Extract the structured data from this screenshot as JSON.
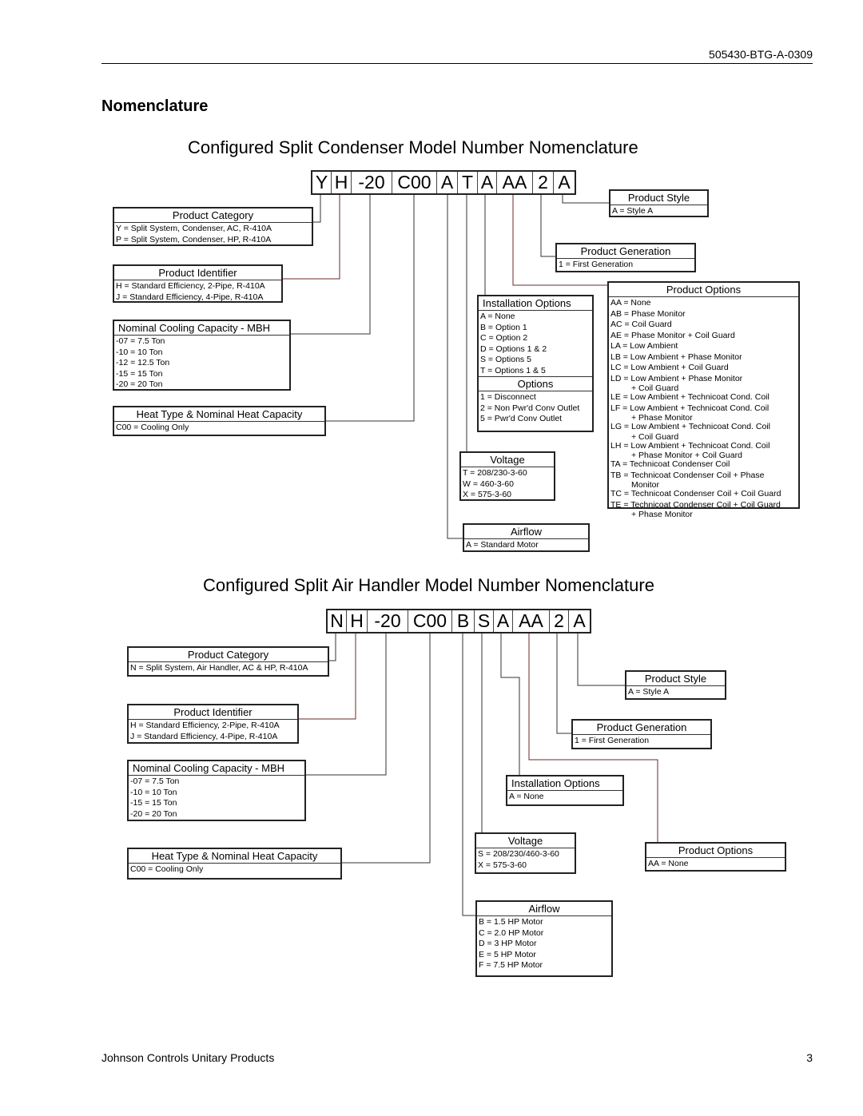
{
  "header": {
    "doc_number": "505430-BTG-A-0309"
  },
  "section_title": "Nomenclature",
  "diagrams": [
    {
      "title": "Configured Split Condenser Model Number Nomenclature",
      "codes": [
        "Y",
        "H",
        "-20",
        "C00",
        "A",
        "T",
        "A",
        "AA",
        "2",
        "A"
      ],
      "boxes": [
        {
          "name": "product-category",
          "sections": [
            {
              "title": "Product Category",
              "items": [
                "Y = Split System, Condenser, AC, R-410A",
                "P = Split System, Condenser, HP, R-410A"
              ]
            }
          ]
        },
        {
          "name": "product-identifier",
          "sections": [
            {
              "title": "Product Identifier",
              "items": [
                "H = Standard Efficiency, 2-Pipe, R-410A",
                "J = Standard Efficiency, 4-Pipe, R-410A"
              ]
            }
          ]
        },
        {
          "name": "nominal-cooling-capacity",
          "sections": [
            {
              "title": "Nominal Cooling Capacity - MBH",
              "items": [
                "-07 = 7.5 Ton",
                "-10 = 10 Ton",
                "-12 = 12.5 Ton",
                "-15 = 15 Ton",
                "-20 = 20 Ton"
              ]
            }
          ]
        },
        {
          "name": "heat-type",
          "sections": [
            {
              "title": "Heat Type & Nominal Heat Capacity",
              "items": [
                "C00 = Cooling Only"
              ]
            }
          ]
        },
        {
          "name": "airflow",
          "sections": [
            {
              "title": "Airflow",
              "items": [
                "A = Standard Motor"
              ]
            }
          ]
        },
        {
          "name": "voltage",
          "sections": [
            {
              "title": "Voltage",
              "items": [
                "T = 208/230-3-60",
                "W = 460-3-60",
                "X = 575-3-60"
              ]
            }
          ]
        },
        {
          "name": "installation-options",
          "sections": [
            {
              "title": "Installation Options",
              "items": [
                "A = None",
                "B = Option 1",
                "C = Option 2",
                "D = Options 1 & 2",
                "S = Options 5",
                "T = Options 1 & 5"
              ]
            },
            {
              "title": "Options",
              "items": [
                "1 = Disconnect",
                "2 = Non Pwr'd Conv Outlet",
                "5 = Pwr'd Conv Outlet"
              ]
            }
          ]
        },
        {
          "name": "product-options",
          "sections": [
            {
              "title": "Product Options",
              "items": [
                "AA = None",
                "AB = Phase Monitor",
                "AC = Coil Guard",
                "AE = Phase Monitor + Coil Guard",
                "LA = Low Ambient",
                "LB = Low Ambient + Phase Monitor",
                "LC = Low Ambient + Coil Guard",
                "LD = Low Ambient + Phase Monitor\n+ Coil Guard",
                "LE = Low Ambient + Technicoat Cond. Coil",
                "LF = Low Ambient + Technicoat Cond. Coil\n+ Phase Monitor",
                "LG = Low Ambient + Technicoat Cond. Coil\n+ Coil Guard",
                "LH = Low Ambient + Technicoat Cond. Coil\n+ Phase Monitor + Coil Guard",
                "TA = Technicoat Condenser Coil",
                "TB = Technicoat Condenser Coil + Phase\nMonitor",
                "TC = Technicoat Condenser Coil + Coil Guard",
                "TE = Technicoat Condenser Coil + Coil Guard\n+ Phase Monitor"
              ]
            }
          ]
        },
        {
          "name": "product-generation",
          "sections": [
            {
              "title": "Product Generation",
              "items": [
                "1 = First Generation"
              ]
            }
          ]
        },
        {
          "name": "product-style",
          "sections": [
            {
              "title": "Product Style",
              "items": [
                "A = Style A"
              ]
            }
          ]
        }
      ]
    },
    {
      "title": "Configured Split Air Handler Model Number Nomenclature",
      "codes": [
        "N",
        "H",
        "-20",
        "C00",
        "B",
        "S",
        "A",
        "AA",
        "2",
        "A"
      ],
      "boxes": [
        {
          "name": "product-category",
          "sections": [
            {
              "title": "Product Category",
              "items": [
                "N = Split System, Air Handler, AC & HP, R-410A"
              ]
            }
          ]
        },
        {
          "name": "product-identifier",
          "sections": [
            {
              "title": "Product Identifier",
              "items": [
                "H = Standard Efficiency, 2-Pipe, R-410A",
                "J = Standard Efficiency, 4-Pipe, R-410A"
              ]
            }
          ]
        },
        {
          "name": "nominal-cooling-capacity",
          "sections": [
            {
              "title": "Nominal Cooling Capacity - MBH",
              "items": [
                "-07 = 7.5 Ton",
                "-10 = 10 Ton",
                "-15 = 15 Ton",
                "-20 = 20 Ton"
              ]
            }
          ]
        },
        {
          "name": "heat-type",
          "sections": [
            {
              "title": "Heat Type & Nominal Heat Capacity",
              "items": [
                "C00 = Cooling Only"
              ]
            }
          ]
        },
        {
          "name": "airflow",
          "sections": [
            {
              "title": "Airflow",
              "items": [
                "B = 1.5 HP Motor",
                "C = 2.0 HP Motor",
                "D = 3 HP Motor",
                "E = 5 HP Motor",
                "F = 7.5 HP Motor"
              ]
            }
          ]
        },
        {
          "name": "voltage",
          "sections": [
            {
              "title": "Voltage",
              "items": [
                "S = 208/230/460-3-60",
                "X = 575-3-60"
              ]
            }
          ]
        },
        {
          "name": "installation-options",
          "sections": [
            {
              "title": "Installation Options",
              "items": [
                "A = None"
              ]
            }
          ]
        },
        {
          "name": "product-options",
          "sections": [
            {
              "title": "Product Options",
              "items": [
                "AA = None"
              ]
            }
          ]
        },
        {
          "name": "product-generation",
          "sections": [
            {
              "title": "Product Generation",
              "items": [
                "1 = First Generation"
              ]
            }
          ]
        },
        {
          "name": "product-style",
          "sections": [
            {
              "title": "Product Style",
              "items": [
                "A = Style A"
              ]
            }
          ]
        }
      ]
    }
  ],
  "footer": {
    "company": "Johnson Controls Unitary Products",
    "page_number": "3"
  }
}
